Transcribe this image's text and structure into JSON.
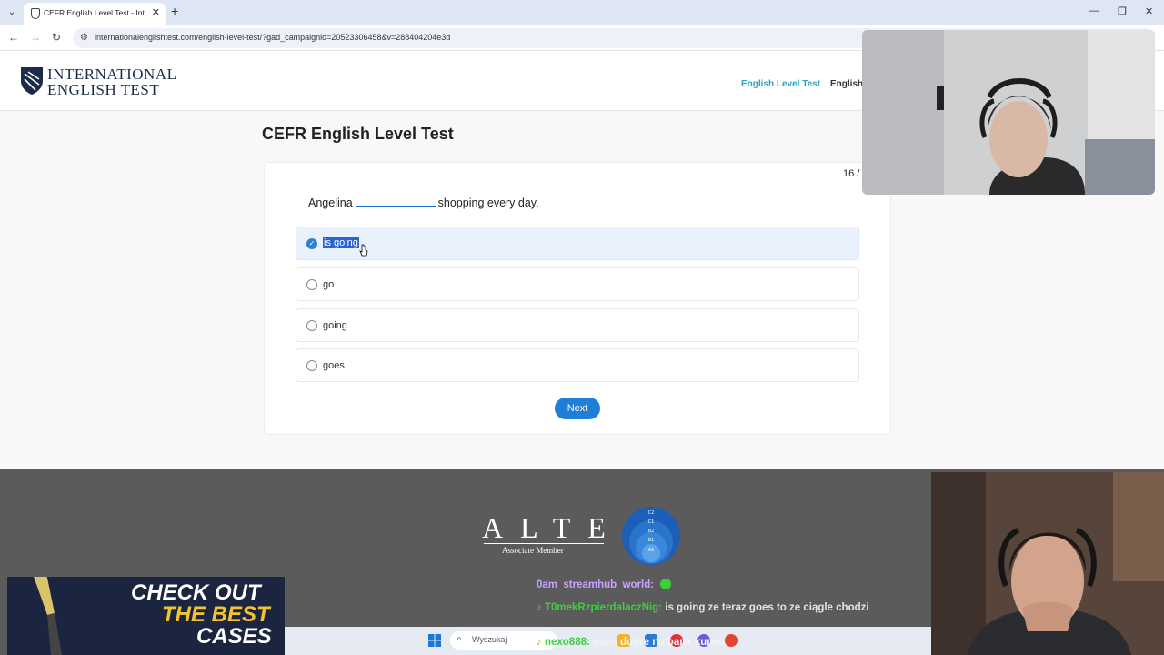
{
  "browser": {
    "tab_title": "CEFR English Level Test - Intern",
    "url": "internationalenglishtest.com/english-level-test/?gad_campaignid=20523306458&v=288404204e3d"
  },
  "site": {
    "logo_line1": "INTERNATIONAL",
    "logo_line2": "ENGLISH TEST",
    "nav": [
      "English Level Test",
      "English"
    ],
    "accent_color": "#2aa5c8"
  },
  "test": {
    "title": "CEFR English Level Test",
    "progress": "16 /",
    "question_before": "Angelina",
    "question_after": "shopping every day.",
    "options": [
      {
        "label": "is going",
        "selected": true
      },
      {
        "label": "go",
        "selected": false
      },
      {
        "label": "going",
        "selected": false
      },
      {
        "label": "goes",
        "selected": false
      }
    ],
    "next_label": "Next"
  },
  "footer": {
    "alte_text": "ALTE",
    "alte_sub": "Associate Member",
    "cefr_levels": [
      "C2",
      "C1",
      "B2",
      "B1",
      "A2"
    ]
  },
  "promo": {
    "line1": "CHECK OUT",
    "line2": "THE BEST",
    "line3": "CASES"
  },
  "chat": [
    {
      "user": "0am_streamhub_world:",
      "text": "",
      "color": "#c8a2ff"
    },
    {
      "user": "T0mekRzpierdalaczNig:",
      "text": "is going ze teraz goes to ze ciągle chodzi",
      "color": "#3ad13a"
    },
    {
      "user": "nexo888:",
      "text": "goes dobre na bank kurwa",
      "color": "#3ad13a"
    }
  ],
  "taskbar": {
    "search_placeholder": "Wyszukaj"
  }
}
